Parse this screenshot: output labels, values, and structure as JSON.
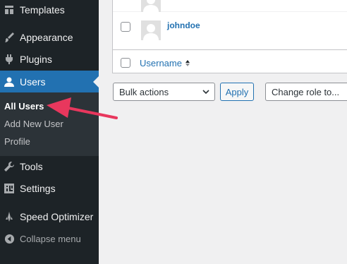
{
  "sidebar": {
    "items": [
      {
        "label": "Templates",
        "icon": "templates-icon"
      },
      {
        "label": "Appearance",
        "icon": "paintbrush-icon"
      },
      {
        "label": "Plugins",
        "icon": "plug-icon"
      },
      {
        "label": "Users",
        "icon": "user-icon"
      },
      {
        "label": "Tools",
        "icon": "wrench-icon"
      },
      {
        "label": "Settings",
        "icon": "settings-icon"
      },
      {
        "label": "Speed Optimizer",
        "icon": "speed-optimizer-icon"
      }
    ],
    "submenu": [
      "All Users",
      "Add New User",
      "Profile"
    ],
    "collapse_label": "Collapse menu"
  },
  "table": {
    "rows": [
      {
        "username": "johndoe"
      }
    ],
    "footer_column": "Username"
  },
  "bulk_actions": {
    "selected": "Bulk actions",
    "apply_label": "Apply"
  },
  "change_role": {
    "selected": "Change role to..."
  },
  "colors": {
    "sidebar_bg": "#1d2327",
    "submenu_bg": "#2c3338",
    "active_bg": "#2271b1",
    "link": "#2271b1",
    "annotation_arrow": "#e8375d"
  }
}
